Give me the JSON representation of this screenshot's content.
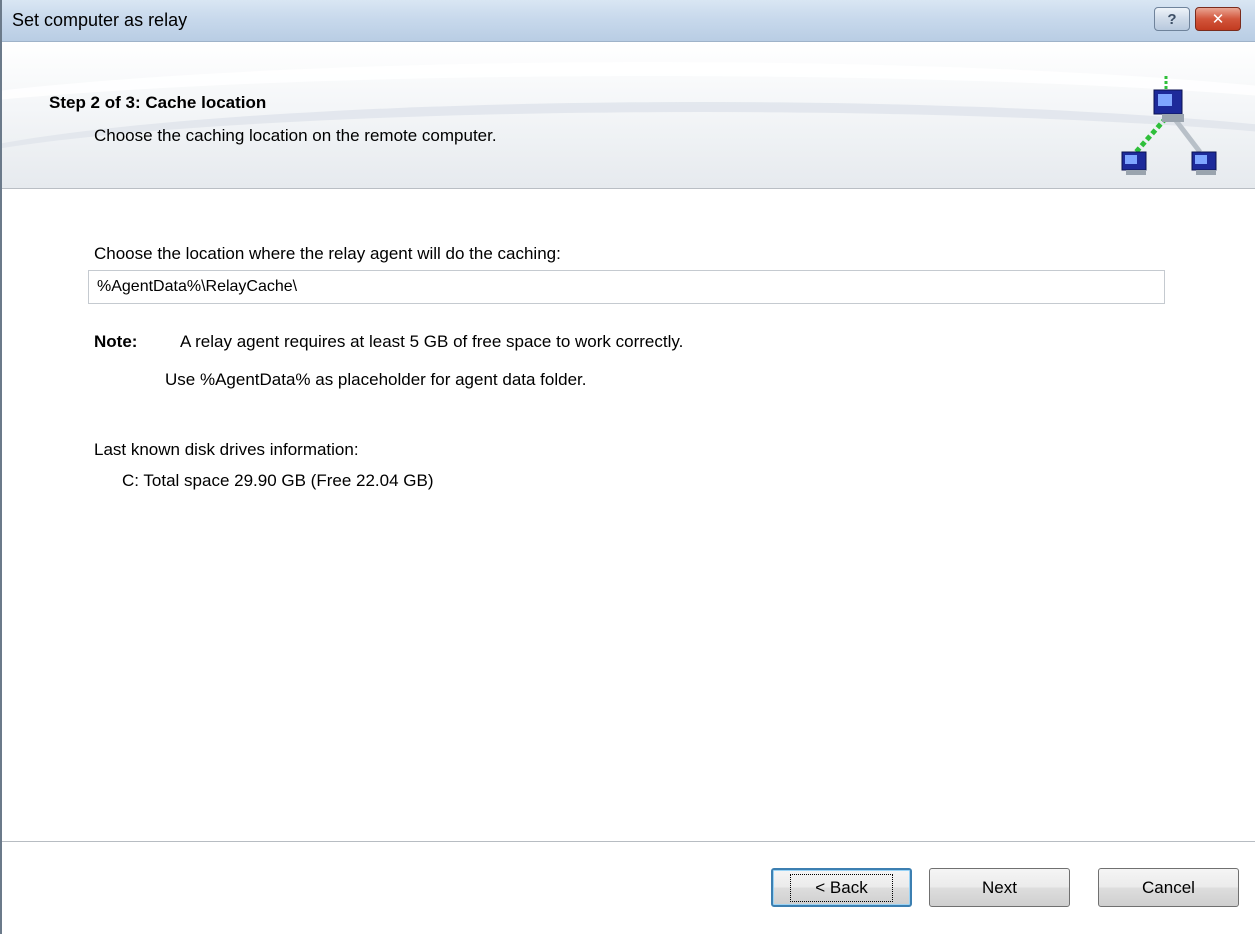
{
  "window": {
    "title": "Set computer as relay",
    "help_button": "?",
    "close_button": "✕"
  },
  "header": {
    "step_title": "Step 2 of 3: Cache location",
    "step_subtitle": "Choose the caching location on the remote computer.",
    "icon": "network-relay-icon"
  },
  "content": {
    "location_label": "Choose the location where the relay agent will do the caching:",
    "location_value": "%AgentData%\\RelayCache\\",
    "note_label": "Note:",
    "note_line1": "A relay agent requires at least 5 GB of free space to work correctly.",
    "note_line2": "Use %AgentData% as placeholder for agent data folder.",
    "disk_label": "Last known disk drives information:",
    "disk_items": [
      "C: Total space 29.90 GB (Free 22.04 GB)"
    ]
  },
  "footer": {
    "back_label": "< Back",
    "next_label": "Next",
    "cancel_label": "Cancel"
  },
  "colors": {
    "titlebar": "#c8d9ec",
    "close_button": "#c9432a",
    "focus_border": "#3c7fb1"
  }
}
